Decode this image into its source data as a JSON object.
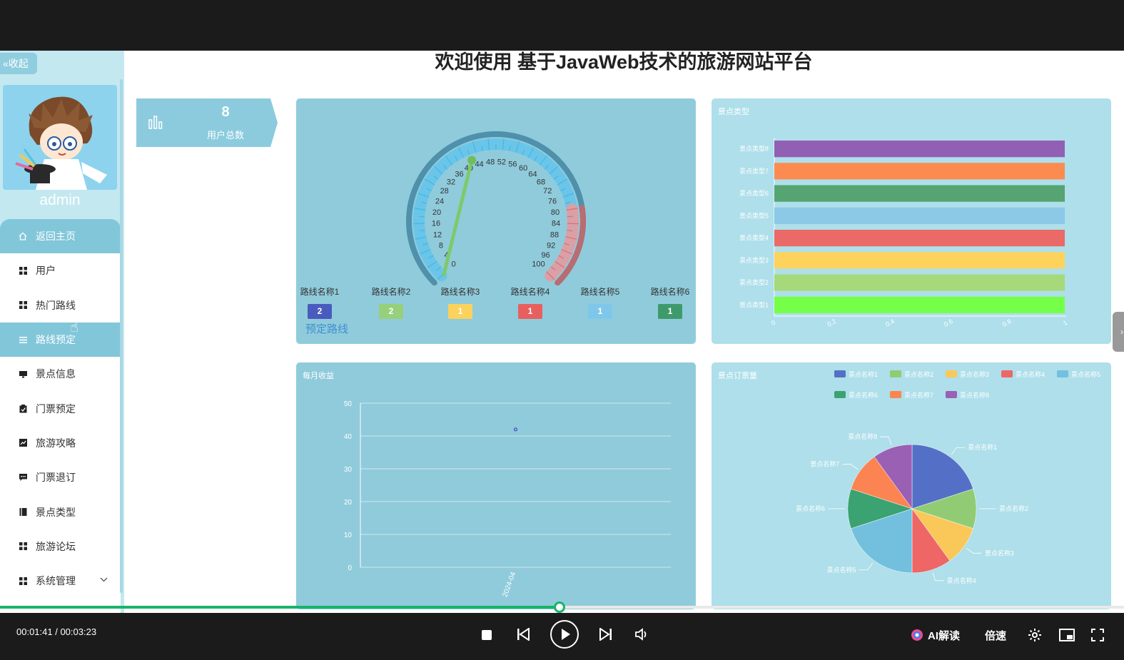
{
  "page": {
    "title": "欢迎使用 基于JavaWeb技术的旅游网站平台"
  },
  "sidebar": {
    "collapse_label": "收起",
    "username": "admin",
    "items": [
      {
        "label": "返回主页",
        "icon": "home-icon",
        "active": true
      },
      {
        "label": "用户",
        "icon": "grid-icon"
      },
      {
        "label": "热门路线",
        "icon": "grid-icon"
      },
      {
        "label": "路线预定",
        "icon": "list-icon",
        "active": true
      },
      {
        "label": "景点信息",
        "icon": "monitor-icon"
      },
      {
        "label": "门票预定",
        "icon": "clipboard-icon"
      },
      {
        "label": "旅游攻略",
        "icon": "chart-icon"
      },
      {
        "label": "门票退订",
        "icon": "comment-icon"
      },
      {
        "label": "景点类型",
        "icon": "book-icon"
      },
      {
        "label": "旅游论坛",
        "icon": "grid-icon"
      },
      {
        "label": "系统管理",
        "icon": "grid-icon",
        "has_submenu": true
      }
    ]
  },
  "stat": {
    "value": "8",
    "label": "用户总数",
    "icon": "bar-chart-icon"
  },
  "gauge": {
    "min": 0,
    "max": 100,
    "value": 42,
    "link_label": "预定路线",
    "ticks": [
      "0",
      "4",
      "8",
      "12",
      "16",
      "20",
      "24",
      "28",
      "32",
      "36",
      "40",
      "44",
      "48",
      "52",
      "56",
      "60",
      "64",
      "68",
      "72",
      "76",
      "80",
      "84",
      "88",
      "92",
      "96",
      "100"
    ],
    "routes": [
      {
        "name": "路线名称1",
        "count": "2",
        "color": "#4a5bbf"
      },
      {
        "name": "路线名称2",
        "count": "2",
        "color": "#96d07a"
      },
      {
        "name": "路线名称3",
        "count": "1",
        "color": "#fbd25c"
      },
      {
        "name": "路线名称4",
        "count": "1",
        "color": "#e8605e"
      },
      {
        "name": "路线名称5",
        "count": "1",
        "color": "#7fc7ea"
      },
      {
        "name": "路线名称6",
        "count": "1",
        "color": "#3f9a6b"
      }
    ]
  },
  "bar_panel_title": "景点类型",
  "line_panel_title": "每月收益",
  "pie_panel_title": "景点订票量",
  "chart_data": [
    {
      "type": "bar",
      "title": "景点类型",
      "orientation": "horizontal",
      "categories": [
        "景点类型1",
        "景点类型2",
        "景点类型3",
        "景点类型4",
        "景点类型5",
        "景点类型6",
        "景点类型7",
        "景点类型8"
      ],
      "values": [
        1,
        1,
        1,
        1,
        1,
        1,
        1,
        1
      ],
      "colors": [
        "#76ff48",
        "#a6d97a",
        "#fdd35d",
        "#e96a67",
        "#8bc9e7",
        "#55a471",
        "#fc8b50",
        "#915fb4"
      ],
      "xticks": [
        "0",
        "0.2",
        "0.4",
        "0.6",
        "0.8",
        "1"
      ],
      "xlim": [
        0,
        1
      ]
    },
    {
      "type": "line",
      "title": "每月收益",
      "x": [
        "2024-04"
      ],
      "values": [
        42
      ],
      "ylim": [
        0,
        50
      ],
      "yticks": [
        "0",
        "10",
        "20",
        "30",
        "40",
        "50"
      ]
    },
    {
      "type": "pie",
      "title": "景点订票量",
      "legend_position": "top-right",
      "labels": [
        "景点名称1",
        "景点名称2",
        "景点名称3",
        "景点名称4",
        "景点名称5",
        "景点名称6",
        "景点名称7",
        "景点名称8"
      ],
      "values": [
        2,
        1,
        1,
        1,
        2,
        1,
        1,
        1
      ],
      "colors": [
        "#5470c6",
        "#91cc75",
        "#fac858",
        "#ee6666",
        "#73c0de",
        "#3ba272",
        "#fc8452",
        "#9a60b4"
      ]
    }
  ],
  "player": {
    "time": "00:01:41 / 00:03:23",
    "progress": 0.498,
    "ai_label": "AI解读",
    "speed_label": "倍速"
  }
}
